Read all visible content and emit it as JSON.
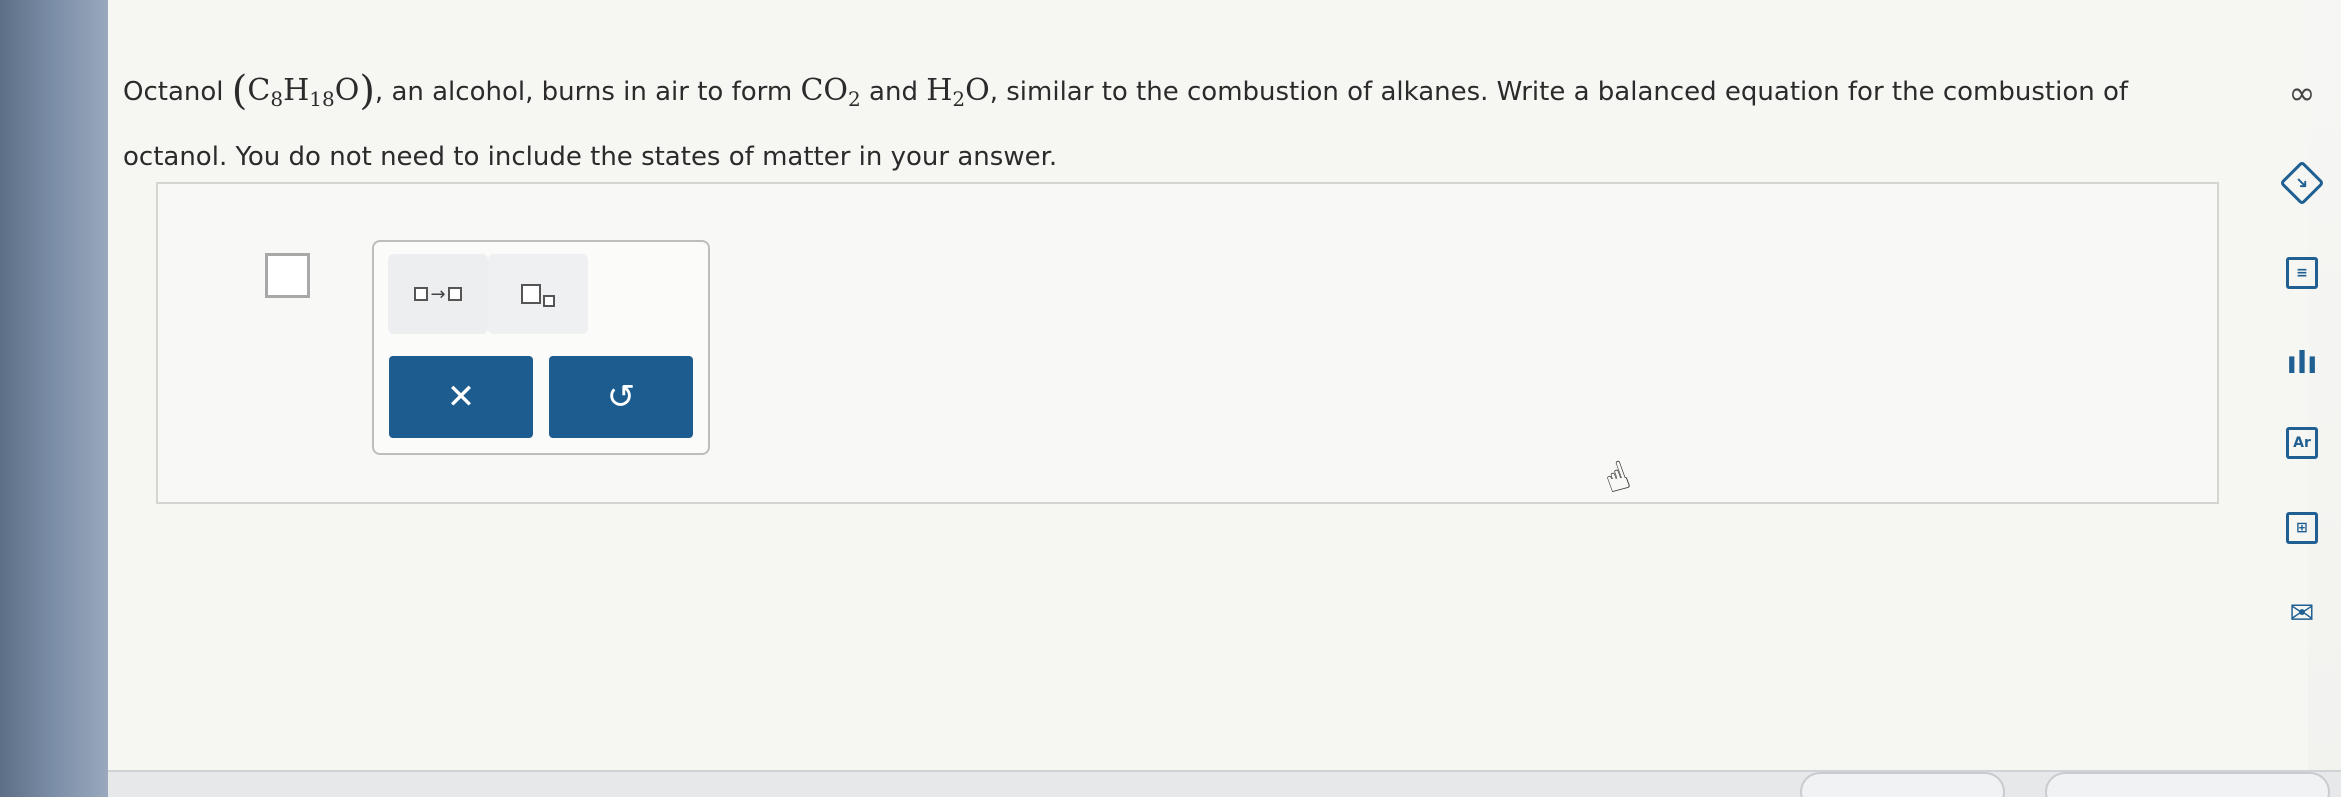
{
  "question": {
    "prefix": "Octanol",
    "formula_C": "C",
    "formula_C_sub": "8",
    "formula_H": "H",
    "formula_H_sub": "18",
    "formula_O": "O",
    "middle1": ", an alcohol, burns in air to form",
    "co2_main": "CO",
    "co2_sub": "2",
    "and_text": "and",
    "h2o_H": "H",
    "h2o_sub": "2",
    "h2o_O": "O",
    "middle2": ", similar to the combustion of alkanes. Write a balanced equation for the combustion of octanol. You do not need to include the states of matter in your answer."
  },
  "palette": {
    "arrow_glyph": "→",
    "clear_symbol": "✕",
    "undo_symbol": "↺"
  },
  "sidebar": {
    "infinity_label": "∞",
    "periodic_label": "Ar",
    "chart_label": "ılı",
    "notes_label": "≡",
    "calc_label": "⊞",
    "mail_label": "✉"
  }
}
